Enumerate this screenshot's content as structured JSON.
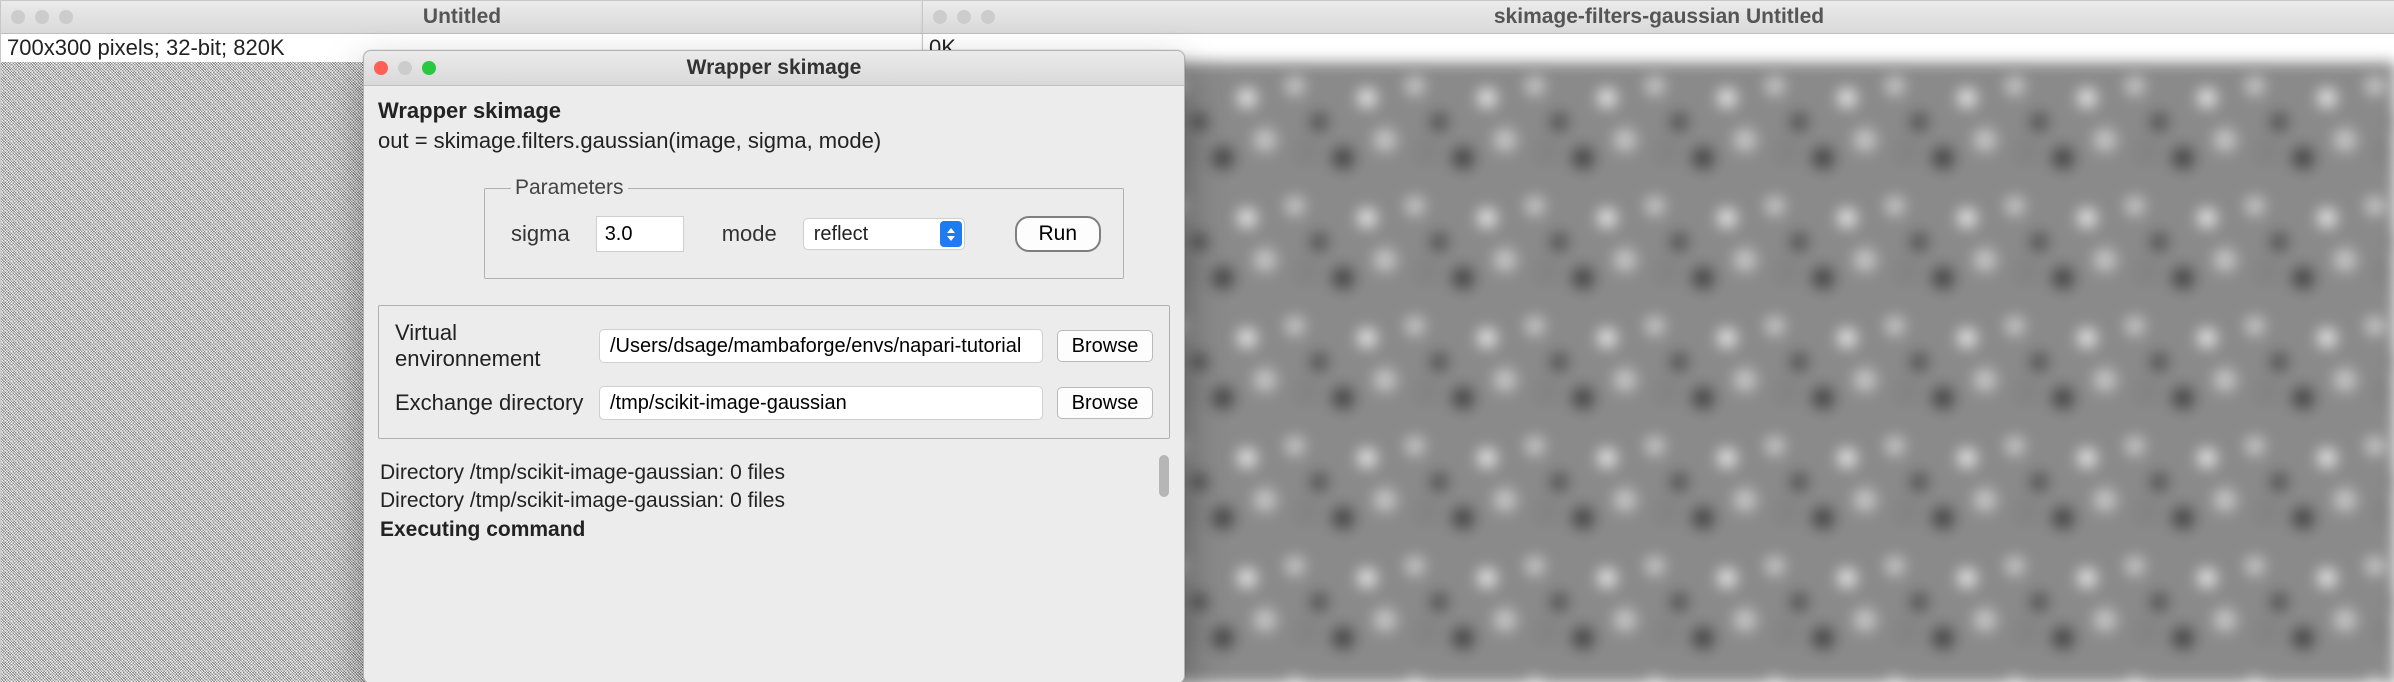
{
  "left_window": {
    "title": "Untitled",
    "info": "700x300 pixels; 32-bit; 820K"
  },
  "right_window": {
    "title": "skimage-filters-gaussian Untitled",
    "info_partial": "0K"
  },
  "dialog": {
    "title": "Wrapper skimage",
    "plugin_title": "Wrapper skimage",
    "snippet": "out = skimage.filters.gaussian(image, sigma, mode)",
    "params": {
      "legend": "Parameters",
      "sigma_label": "sigma",
      "sigma_value": "3.0",
      "mode_label": "mode",
      "mode_value": "reflect",
      "run_label": "Run"
    },
    "paths": {
      "venv_label": "Virtual environnement",
      "venv_value": "/Users/dsage/mambaforge/envs/napari-tutorial",
      "exchange_label": "Exchange directory",
      "exchange_value": "/tmp/scikit-image-gaussian",
      "browse_label": "Browse"
    },
    "log": [
      {
        "text": "Directory /tmp/scikit-image-gaussian: 0 files",
        "bold": false
      },
      {
        "text": "Directory /tmp/scikit-image-gaussian: 0 files",
        "bold": false
      },
      {
        "text": "Executing command",
        "bold": true
      }
    ]
  }
}
